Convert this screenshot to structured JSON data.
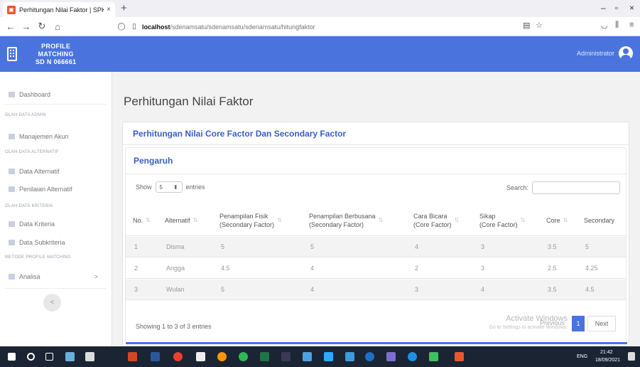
{
  "browser": {
    "tab_title": "Perhitungan Nilai Faktor | SPK P",
    "tab_close": "×",
    "new_tab": "+",
    "url_host": "localhost",
    "url_path": "/sdenamsatu/sdenamsatu/sdenamsatu/hitungfaktor",
    "win_min": "–",
    "win_max": "▫",
    "win_close": "×"
  },
  "header": {
    "brand_line1": "PROFILE",
    "brand_line2": "MATCHING",
    "brand_line3": "SD N 066661",
    "user_name": "Administrator"
  },
  "sidebar": {
    "dashboard": "Dashboard",
    "section_admin": "OLAH DATA ADMIN",
    "akun": "Manajemen Akun",
    "section_alternatif": "OLAH DATA ALTERNATIF",
    "data_alternatif": "Data Alternatif",
    "penilaian": "Penilaian Alternatif",
    "section_kriteria": "OLAH DATA KRITERIA",
    "data_kriteria": "Data Kriteria",
    "data_subkriteria": "Data Subkriteria",
    "section_metode": "METODE PROFILE MATCHING",
    "analisa": "Analisa",
    "analisa_chevron": ">",
    "collapse": "<"
  },
  "main": {
    "page_title": "Perhitungan Nilai Faktor",
    "card_title": "Perhitungan Nilai Core Factor Dan Secondary Factor",
    "inner_title": "Pengaruh",
    "show_label": "Show",
    "show_value": "5",
    "entries_label": "entries",
    "search_label": "Search:",
    "info": "Showing 1 to 3 of 3 entries",
    "activate_line1": "Activate Windows",
    "activate_line2": "Go to Settings to activate Windows.",
    "prev": "Previous",
    "page": "1",
    "next": "Next"
  },
  "table": {
    "headers": [
      {
        "line1": "No.",
        "line2": ""
      },
      {
        "line1": "Alternatif",
        "line2": ""
      },
      {
        "line1": "Penampilan Fisik",
        "line2": "(Secondary Factor)"
      },
      {
        "line1": "Penampilan Berbusana",
        "line2": "(Secondary Factor)"
      },
      {
        "line1": "Cara Bicara",
        "line2": "(Core Factor)"
      },
      {
        "line1": "Sikap",
        "line2": "(Core Factor)"
      },
      {
        "line1": "Core",
        "line2": ""
      },
      {
        "line1": "Secondary",
        "line2": ""
      }
    ],
    "rows": [
      [
        "1",
        "Disma",
        "5",
        "5",
        "4",
        "3",
        "3.5",
        "5"
      ],
      [
        "2",
        "Angga",
        "4.5",
        "4",
        "2",
        "3",
        "2.5",
        "4.25"
      ],
      [
        "3",
        "Wulan",
        "5",
        "4",
        "3",
        "4",
        "3.5",
        "4.5"
      ]
    ]
  },
  "taskbar": {
    "lang": "ENG",
    "time": "21:42",
    "date": "18/09/2021"
  },
  "colors": {
    "accent": "#4a73dd",
    "title_blue": "#3a5dc8",
    "taskbar": "#1a2433"
  }
}
